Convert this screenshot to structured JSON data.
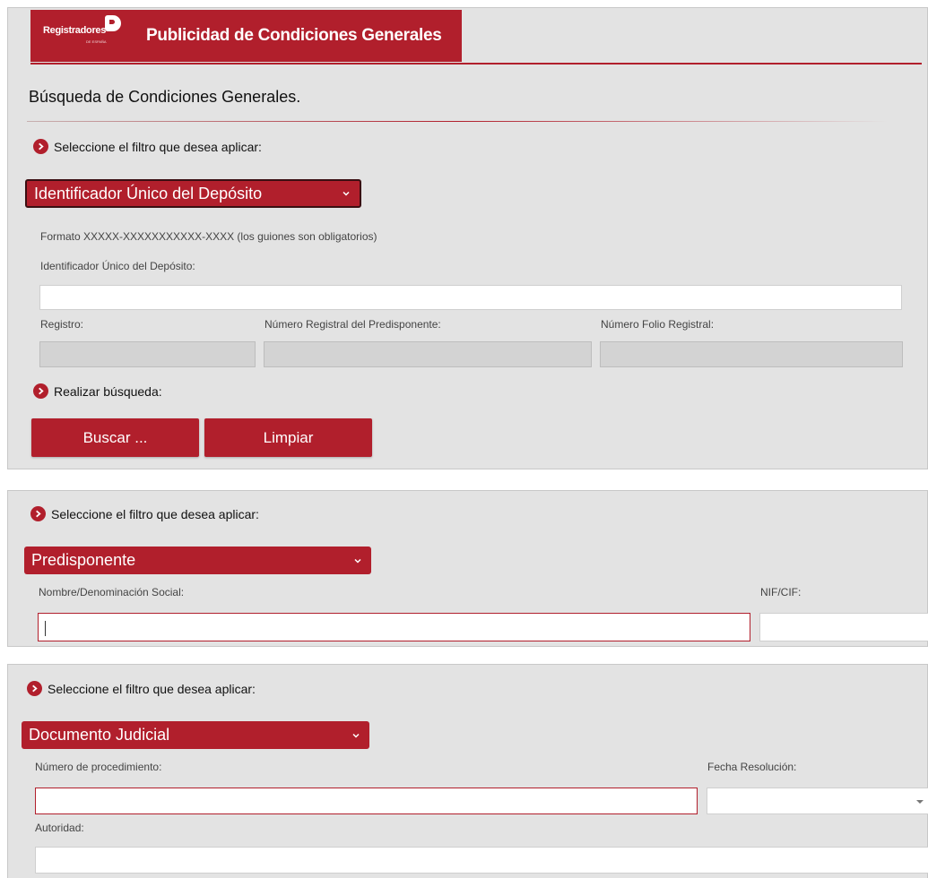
{
  "header": {
    "logo_text": "Registradores",
    "logo_sub": "DE ESPAÑA",
    "title": "Publicidad de Condiciones Generales"
  },
  "section1": {
    "page_title": "Búsqueda de Condiciones Generales.",
    "filter_prompt": "Seleccione el filtro que desea aplicar:",
    "filter_selected": "Identificador Único del Depósito",
    "format_note": "Formato XXXXX-XXXXXXXXXXX-XXXX (los guiones son obligatorios)",
    "id_label": "Identificador Único del Depósito:",
    "id_value": "",
    "registro_label": "Registro:",
    "numero_registral_label": "Número Registral del Predisponente:",
    "folio_label": "Número Folio Registral:",
    "search_prompt": "Realizar búsqueda:",
    "buscar_label": "Buscar ...",
    "limpiar_label": "Limpiar"
  },
  "section2": {
    "filter_prompt": "Seleccione el filtro que desea aplicar:",
    "filter_selected": "Predisponente",
    "nombre_label": "Nombre/Denominación Social:",
    "nombre_value": "",
    "nif_label": "NIF/CIF:",
    "nif_value": ""
  },
  "section3": {
    "filter_prompt": "Seleccione el filtro que desea aplicar:",
    "filter_selected": "Documento Judicial",
    "procedimiento_label": "Número de procedimiento:",
    "procedimiento_value": "",
    "fecha_label": "Fecha Resolución:",
    "fecha_value": "",
    "autoridad_label": "Autoridad:",
    "autoridad_value": ""
  },
  "colors": {
    "brand_red": "#b11f2c",
    "panel_bg": "#e3e3e3"
  }
}
